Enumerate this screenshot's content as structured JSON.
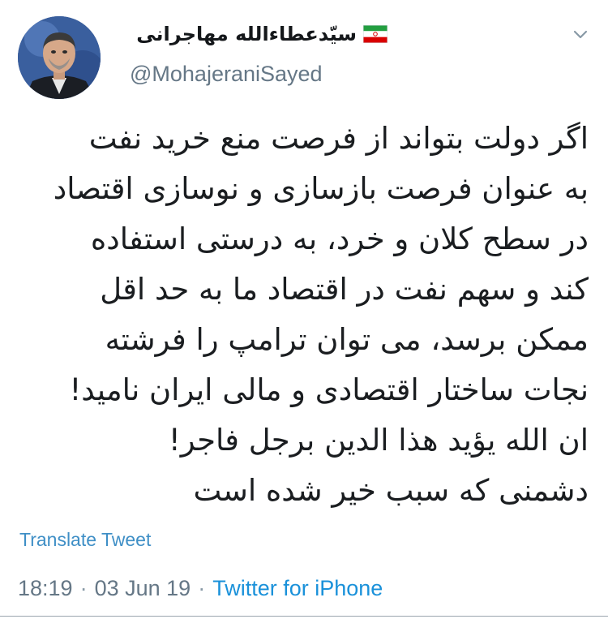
{
  "author": {
    "display_name": "سیّدعطاءالله مهاجرانی",
    "handle": "@MohajeraniSayed",
    "flag_icon": "iran-flag-icon",
    "avatar_icon": "profile-photo-avatar"
  },
  "header": {
    "menu_icon": "chevron-down-icon"
  },
  "tweet": {
    "lines": [
      "اگر دولت بتواند از فرصت منع خرید نفت",
      "به عنوان فرصت بازسازی و نوسازی اقتصاد",
      "در سطح کلان و خرد، به درستی استفاده",
      "کند و سهم نفت در اقتصاد ما به حد اقل",
      "ممکن برسد، می توان ترامپ را فرشته",
      "نجات ساختار اقتصادی و مالی ایران نامید!",
      "ان الله یؤید هذا الدین برجل فاجر!",
      "دشمنی که سبب خیر شده است"
    ]
  },
  "actions": {
    "translate_label": "Translate Tweet"
  },
  "meta": {
    "time": "18:19",
    "date": "03 Jun 19",
    "separator": "·",
    "source": "Twitter for iPhone"
  },
  "colors": {
    "link": "#1a91da",
    "translate_link": "#3f8fc6",
    "muted": "#657786",
    "text": "#14171a",
    "flag_green": "#239f40",
    "flag_red": "#da0000"
  }
}
